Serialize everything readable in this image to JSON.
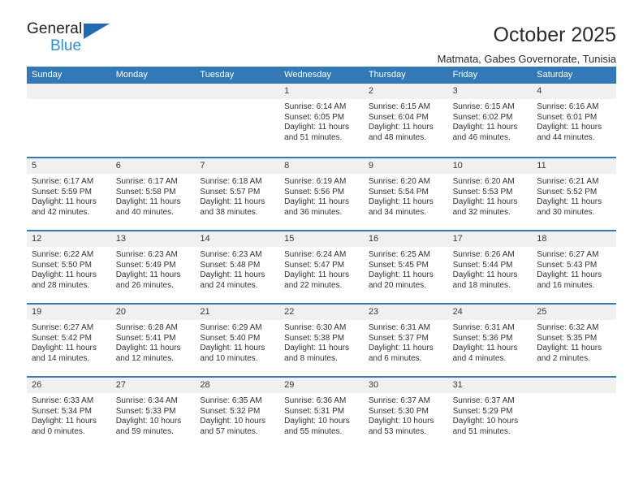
{
  "brand": {
    "name_top": "General",
    "name_bottom": "Blue",
    "triangle_color": "#1f6cb4",
    "blue_text_color": "#2a8fd4"
  },
  "header": {
    "title": "October 2025",
    "subtitle": "Matmata, Gabes Governorate, Tunisia"
  },
  "colors": {
    "header_band": "#3479b7",
    "date_strip": "#f0f0f0",
    "row_divider": "#3479b7",
    "text": "#333333"
  },
  "weekdays": [
    "Sunday",
    "Monday",
    "Tuesday",
    "Wednesday",
    "Thursday",
    "Friday",
    "Saturday"
  ],
  "weeks": [
    [
      {
        "empty": true
      },
      {
        "empty": true
      },
      {
        "empty": true
      },
      {
        "day": "1",
        "sunrise": "Sunrise: 6:14 AM",
        "sunset": "Sunset: 6:05 PM",
        "daylight1": "Daylight: 11 hours",
        "daylight2": "and 51 minutes."
      },
      {
        "day": "2",
        "sunrise": "Sunrise: 6:15 AM",
        "sunset": "Sunset: 6:04 PM",
        "daylight1": "Daylight: 11 hours",
        "daylight2": "and 48 minutes."
      },
      {
        "day": "3",
        "sunrise": "Sunrise: 6:15 AM",
        "sunset": "Sunset: 6:02 PM",
        "daylight1": "Daylight: 11 hours",
        "daylight2": "and 46 minutes."
      },
      {
        "day": "4",
        "sunrise": "Sunrise: 6:16 AM",
        "sunset": "Sunset: 6:01 PM",
        "daylight1": "Daylight: 11 hours",
        "daylight2": "and 44 minutes."
      }
    ],
    [
      {
        "day": "5",
        "sunrise": "Sunrise: 6:17 AM",
        "sunset": "Sunset: 5:59 PM",
        "daylight1": "Daylight: 11 hours",
        "daylight2": "and 42 minutes."
      },
      {
        "day": "6",
        "sunrise": "Sunrise: 6:17 AM",
        "sunset": "Sunset: 5:58 PM",
        "daylight1": "Daylight: 11 hours",
        "daylight2": "and 40 minutes."
      },
      {
        "day": "7",
        "sunrise": "Sunrise: 6:18 AM",
        "sunset": "Sunset: 5:57 PM",
        "daylight1": "Daylight: 11 hours",
        "daylight2": "and 38 minutes."
      },
      {
        "day": "8",
        "sunrise": "Sunrise: 6:19 AM",
        "sunset": "Sunset: 5:56 PM",
        "daylight1": "Daylight: 11 hours",
        "daylight2": "and 36 minutes."
      },
      {
        "day": "9",
        "sunrise": "Sunrise: 6:20 AM",
        "sunset": "Sunset: 5:54 PM",
        "daylight1": "Daylight: 11 hours",
        "daylight2": "and 34 minutes."
      },
      {
        "day": "10",
        "sunrise": "Sunrise: 6:20 AM",
        "sunset": "Sunset: 5:53 PM",
        "daylight1": "Daylight: 11 hours",
        "daylight2": "and 32 minutes."
      },
      {
        "day": "11",
        "sunrise": "Sunrise: 6:21 AM",
        "sunset": "Sunset: 5:52 PM",
        "daylight1": "Daylight: 11 hours",
        "daylight2": "and 30 minutes."
      }
    ],
    [
      {
        "day": "12",
        "sunrise": "Sunrise: 6:22 AM",
        "sunset": "Sunset: 5:50 PM",
        "daylight1": "Daylight: 11 hours",
        "daylight2": "and 28 minutes."
      },
      {
        "day": "13",
        "sunrise": "Sunrise: 6:23 AM",
        "sunset": "Sunset: 5:49 PM",
        "daylight1": "Daylight: 11 hours",
        "daylight2": "and 26 minutes."
      },
      {
        "day": "14",
        "sunrise": "Sunrise: 6:23 AM",
        "sunset": "Sunset: 5:48 PM",
        "daylight1": "Daylight: 11 hours",
        "daylight2": "and 24 minutes."
      },
      {
        "day": "15",
        "sunrise": "Sunrise: 6:24 AM",
        "sunset": "Sunset: 5:47 PM",
        "daylight1": "Daylight: 11 hours",
        "daylight2": "and 22 minutes."
      },
      {
        "day": "16",
        "sunrise": "Sunrise: 6:25 AM",
        "sunset": "Sunset: 5:45 PM",
        "daylight1": "Daylight: 11 hours",
        "daylight2": "and 20 minutes."
      },
      {
        "day": "17",
        "sunrise": "Sunrise: 6:26 AM",
        "sunset": "Sunset: 5:44 PM",
        "daylight1": "Daylight: 11 hours",
        "daylight2": "and 18 minutes."
      },
      {
        "day": "18",
        "sunrise": "Sunrise: 6:27 AM",
        "sunset": "Sunset: 5:43 PM",
        "daylight1": "Daylight: 11 hours",
        "daylight2": "and 16 minutes."
      }
    ],
    [
      {
        "day": "19",
        "sunrise": "Sunrise: 6:27 AM",
        "sunset": "Sunset: 5:42 PM",
        "daylight1": "Daylight: 11 hours",
        "daylight2": "and 14 minutes."
      },
      {
        "day": "20",
        "sunrise": "Sunrise: 6:28 AM",
        "sunset": "Sunset: 5:41 PM",
        "daylight1": "Daylight: 11 hours",
        "daylight2": "and 12 minutes."
      },
      {
        "day": "21",
        "sunrise": "Sunrise: 6:29 AM",
        "sunset": "Sunset: 5:40 PM",
        "daylight1": "Daylight: 11 hours",
        "daylight2": "and 10 minutes."
      },
      {
        "day": "22",
        "sunrise": "Sunrise: 6:30 AM",
        "sunset": "Sunset: 5:38 PM",
        "daylight1": "Daylight: 11 hours",
        "daylight2": "and 8 minutes."
      },
      {
        "day": "23",
        "sunrise": "Sunrise: 6:31 AM",
        "sunset": "Sunset: 5:37 PM",
        "daylight1": "Daylight: 11 hours",
        "daylight2": "and 6 minutes."
      },
      {
        "day": "24",
        "sunrise": "Sunrise: 6:31 AM",
        "sunset": "Sunset: 5:36 PM",
        "daylight1": "Daylight: 11 hours",
        "daylight2": "and 4 minutes."
      },
      {
        "day": "25",
        "sunrise": "Sunrise: 6:32 AM",
        "sunset": "Sunset: 5:35 PM",
        "daylight1": "Daylight: 11 hours",
        "daylight2": "and 2 minutes."
      }
    ],
    [
      {
        "day": "26",
        "sunrise": "Sunrise: 6:33 AM",
        "sunset": "Sunset: 5:34 PM",
        "daylight1": "Daylight: 11 hours",
        "daylight2": "and 0 minutes."
      },
      {
        "day": "27",
        "sunrise": "Sunrise: 6:34 AM",
        "sunset": "Sunset: 5:33 PM",
        "daylight1": "Daylight: 10 hours",
        "daylight2": "and 59 minutes."
      },
      {
        "day": "28",
        "sunrise": "Sunrise: 6:35 AM",
        "sunset": "Sunset: 5:32 PM",
        "daylight1": "Daylight: 10 hours",
        "daylight2": "and 57 minutes."
      },
      {
        "day": "29",
        "sunrise": "Sunrise: 6:36 AM",
        "sunset": "Sunset: 5:31 PM",
        "daylight1": "Daylight: 10 hours",
        "daylight2": "and 55 minutes."
      },
      {
        "day": "30",
        "sunrise": "Sunrise: 6:37 AM",
        "sunset": "Sunset: 5:30 PM",
        "daylight1": "Daylight: 10 hours",
        "daylight2": "and 53 minutes."
      },
      {
        "day": "31",
        "sunrise": "Sunrise: 6:37 AM",
        "sunset": "Sunset: 5:29 PM",
        "daylight1": "Daylight: 10 hours",
        "daylight2": "and 51 minutes."
      },
      {
        "empty": true
      }
    ]
  ]
}
